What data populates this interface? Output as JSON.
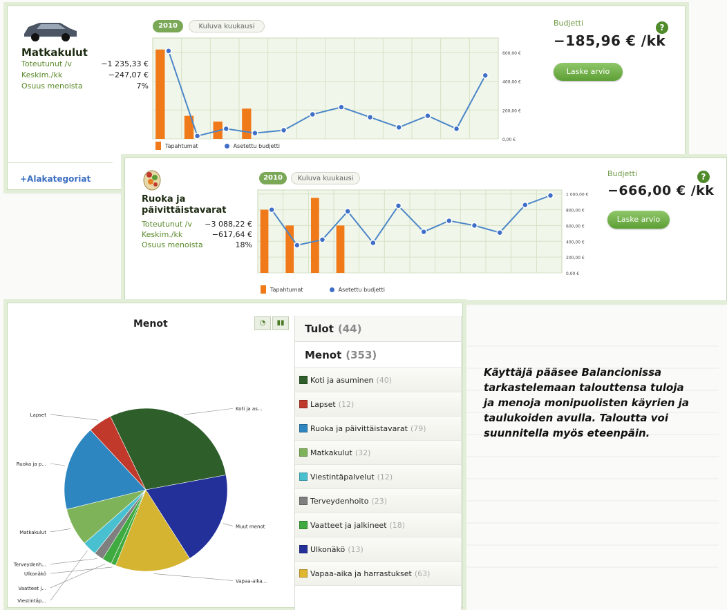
{
  "travel_panel": {
    "title": "Matkakulut",
    "stats": [
      {
        "label": "Toteutunut /v",
        "value": "−1 235,33 €"
      },
      {
        "label": "Keskim./kk",
        "value": "−247,07 €"
      },
      {
        "label": "Osuus menoista",
        "value": "7%"
      }
    ],
    "year_pill": "2010",
    "month_pill": "Kuluva kuukausi",
    "budget_label": "Budjetti",
    "budget_value": "−185,96 € /kk",
    "button_label": "Laske arvio",
    "help": "?",
    "subcategories_link": "+Alakategoriat",
    "legend": {
      "bars": "Tapahtumat",
      "line": "Asetettu budjetti"
    }
  },
  "food_panel": {
    "title_line1": "Ruoka ja",
    "title_line2": "päivittäistavarat",
    "stats": [
      {
        "label": "Toteutunut /v",
        "value": "−3 088,22 €"
      },
      {
        "label": "Keskim./kk",
        "value": "−617,64 €"
      },
      {
        "label": "Osuus menoista",
        "value": "18%"
      }
    ],
    "year_pill": "2010",
    "month_pill": "Kuluva kuukausi",
    "budget_label": "Budjetti",
    "budget_value": "−666,00 € /kk",
    "button_label": "Laske arvio",
    "help": "?",
    "legend": {
      "bars": "Tapahtumat",
      "line": "Asetettu budjetti"
    }
  },
  "menot_panel": {
    "title": "Menot"
  },
  "category_list": {
    "tulot": {
      "label": "Tulot",
      "count": "(44)"
    },
    "menot": {
      "label": "Menot",
      "count": "(353)"
    },
    "items": [
      {
        "label": "Koti ja asuminen",
        "count": "(40)",
        "color": "#2e5e2a"
      },
      {
        "label": "Lapset",
        "count": "(12)",
        "color": "#c0392b"
      },
      {
        "label": "Ruoka ja päivittäistavarat",
        "count": "(79)",
        "color": "#2e86c1"
      },
      {
        "label": "Matkakulut",
        "count": "(32)",
        "color": "#7fb35a"
      },
      {
        "label": "Viestintäpalvelut",
        "count": "(12)",
        "color": "#48c0d0"
      },
      {
        "label": "Terveydenhoito",
        "count": "(23)",
        "color": "#7f7f7f"
      },
      {
        "label": "Vaatteet ja jalkineet",
        "count": "(18)",
        "color": "#3faa3f"
      },
      {
        "label": "Ulkonäkö",
        "count": "(13)",
        "color": "#23309a"
      },
      {
        "label": "Vapaa-aika ja harrastukset",
        "count": "(63)",
        "color": "#e0b530"
      }
    ]
  },
  "caption": "Käyttäjä pääsee Balancionissa tarkastelemaan talouttensa tuloja ja menoja monipuolisten käyrien ja taulukoiden avulla. Taloutta voi suunnitella myös eteenpäin.",
  "chart_data": [
    {
      "type": "bar",
      "title": "",
      "y_ticks": [
        "0,00 €",
        "200,00 €",
        "400,00 €",
        "600,00 €"
      ],
      "ylim": [
        0,
        700
      ],
      "series": [
        {
          "name": "Tapahtumat",
          "type": "bar",
          "values": [
            620,
            160,
            120,
            210,
            0,
            0,
            0,
            0,
            0,
            0,
            0,
            0
          ]
        },
        {
          "name": "Asetettu budjetti",
          "type": "line",
          "values": [
            610,
            20,
            70,
            40,
            60,
            170,
            220,
            150,
            80,
            160,
            70,
            440
          ]
        }
      ]
    },
    {
      "type": "bar",
      "title": "",
      "y_ticks": [
        "0,00 €",
        "200,00 €",
        "400,00 €",
        "600,00 €",
        "800,00 €",
        "1 000,00 €"
      ],
      "ylim": [
        0,
        1050
      ],
      "series": [
        {
          "name": "Tapahtumat",
          "type": "bar",
          "values": [
            800,
            600,
            950,
            600,
            0,
            0,
            0,
            0,
            0,
            0,
            0,
            0
          ]
        },
        {
          "name": "Asetettu budjetti",
          "type": "line",
          "values": [
            800,
            350,
            420,
            780,
            380,
            850,
            520,
            660,
            600,
            510,
            860,
            980
          ]
        }
      ]
    },
    {
      "type": "pie",
      "title": "Menot",
      "slices": [
        {
          "label": "Koti ja as...",
          "value": 31,
          "color": "#2e5e2a"
        },
        {
          "label": "Muut menot",
          "value": 20,
          "color": "#23309a"
        },
        {
          "label": "Vapaa-aika...",
          "value": 16,
          "color": "#d4b431"
        },
        {
          "label": "Ulkonäkö",
          "value": 1,
          "color": "#3faa3f"
        },
        {
          "label": "Vaatteet j...",
          "value": 2,
          "color": "#3faa3f"
        },
        {
          "label": "Terveydenh...",
          "value": 2,
          "color": "#7f7f7f"
        },
        {
          "label": "Viestintäp...",
          "value": 3,
          "color": "#48c0d0"
        },
        {
          "label": "Matkakulut",
          "value": 8,
          "color": "#7fb35a"
        },
        {
          "label": "Ruoka ja p...",
          "value": 18,
          "color": "#2e86c1"
        },
        {
          "label": "Lapset",
          "value": 5,
          "color": "#c0392b"
        }
      ]
    }
  ]
}
